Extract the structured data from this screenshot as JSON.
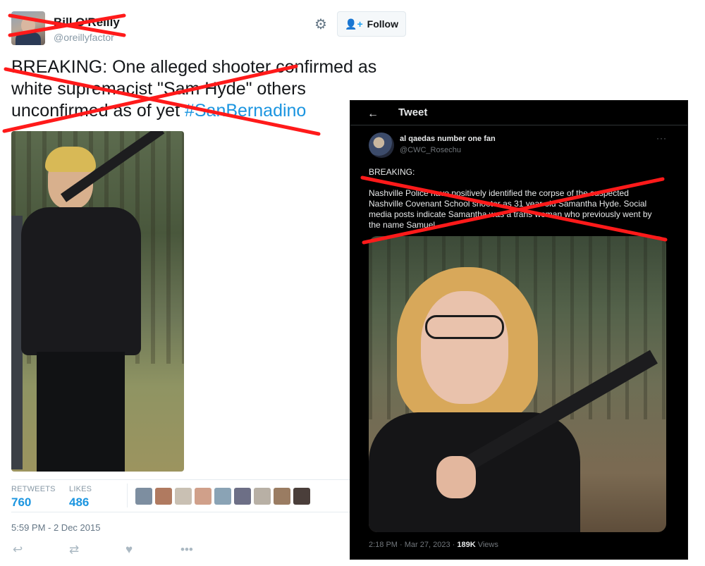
{
  "old_tweet": {
    "author_name": "Bill O'Reilly",
    "author_handle": "@oreillyfactor",
    "follow_label": "Follow",
    "text_main": "BREAKING: One alleged shooter confirmed as white supremacist \"Sam Hyde\" others unconfirmed as of yet ",
    "hashtag": "#SanBernadino",
    "retweets_label": "RETWEETS",
    "retweets_count": "760",
    "likes_label": "LIKES",
    "likes_count": "486",
    "timestamp": "5:59 PM - 2 Dec 2015",
    "liker_colors": [
      "#7d8ea0",
      "#b07a60",
      "#c9c0b3",
      "#d0a08a",
      "#8aa3b5",
      "#6d6f86",
      "#b8b0a5",
      "#9a7c62",
      "#4a3e3a"
    ],
    "icons": [
      "gear-icon",
      "add-user-icon",
      "reply-icon",
      "retweet-icon",
      "like-icon",
      "more-icon"
    ]
  },
  "new_tweet": {
    "header_title": "Tweet",
    "author_name": "al qaedas number one fan",
    "author_handle": "@CWC_Rosechu",
    "text_line1": "BREAKING:",
    "text_body": "Nashville Police have positively identified the corpse of the suspected Nashville Covenant School shooter as 31 year old Samantha Hyde. Social media posts indicate Samantha was a trans woman who previously went by the name Samuel",
    "timestamp": "2:18 PM · Mar 27, 2023 · ",
    "views_count": "189K",
    "views_label": " Views",
    "icons": [
      "back-arrow-icon",
      "more-icon"
    ]
  },
  "colors": {
    "strike_red": "#ff1a1a",
    "link_blue": "#1b95e0",
    "dark_bg": "#000000"
  }
}
